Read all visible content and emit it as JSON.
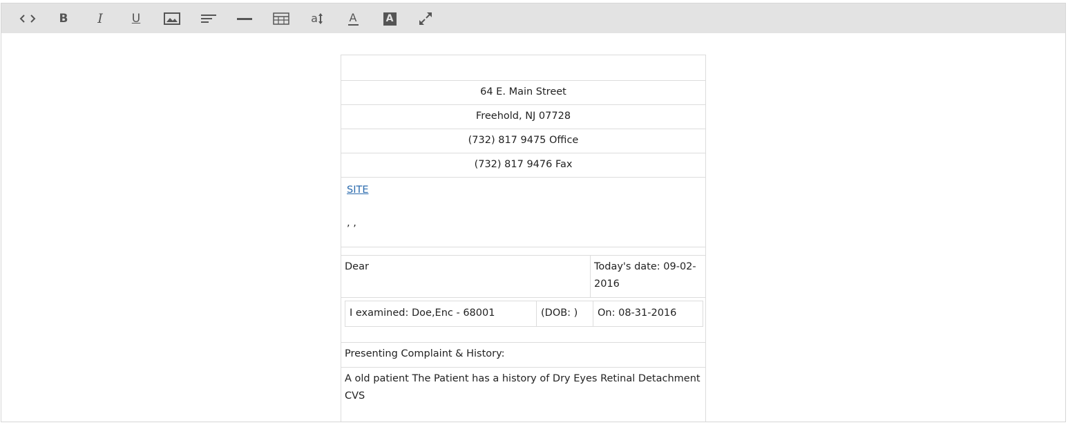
{
  "toolbar": {
    "buttons": [
      {
        "name": "code-view-button",
        "icon": "code-icon",
        "glyph": "<>"
      },
      {
        "name": "bold-button",
        "icon": "bold-icon",
        "glyph": "B"
      },
      {
        "name": "italic-button",
        "icon": "italic-icon",
        "glyph": "I"
      },
      {
        "name": "underline-button",
        "icon": "underline-icon",
        "glyph": "U"
      },
      {
        "name": "insert-image-button",
        "icon": "image-icon"
      },
      {
        "name": "align-button",
        "icon": "align-left-icon"
      },
      {
        "name": "horizontal-rule-button",
        "icon": "horizontal-rule-icon"
      },
      {
        "name": "insert-table-button",
        "icon": "table-icon"
      },
      {
        "name": "font-size-button",
        "icon": "font-size-icon",
        "glyph": "a"
      },
      {
        "name": "text-color-button",
        "icon": "text-color-icon",
        "glyph": "A"
      },
      {
        "name": "background-color-button",
        "icon": "background-color-icon",
        "glyph": "A"
      },
      {
        "name": "fullscreen-button",
        "icon": "expand-icon"
      }
    ]
  },
  "letter": {
    "address": "64 E. Main Street",
    "city": "Freehold, NJ 07728",
    "office": "(732) 817 9475 Office",
    "fax": "(732) 817 9476 Fax",
    "site_link": "SITE",
    "recipient_line": ", ,",
    "dear": "Dear",
    "todays_date_line1": "Today's date: 09-02-",
    "todays_date_line2": "2016",
    "examined": "I examined: Doe,Enc - 68001",
    "dob": "(DOB: )",
    "on_date": "On: 08-31-2016",
    "complaint_heading": "Presenting Complaint & History:",
    "complaint_line1": "A old patient The Patient has a history of Dry Eyes Retinal Detachment",
    "complaint_line2": "CVS"
  },
  "colors": {
    "toolbar_bg": "#e3e3e3",
    "icon": "#555555",
    "link": "#2a6aad",
    "border": "#dcdcdc"
  }
}
